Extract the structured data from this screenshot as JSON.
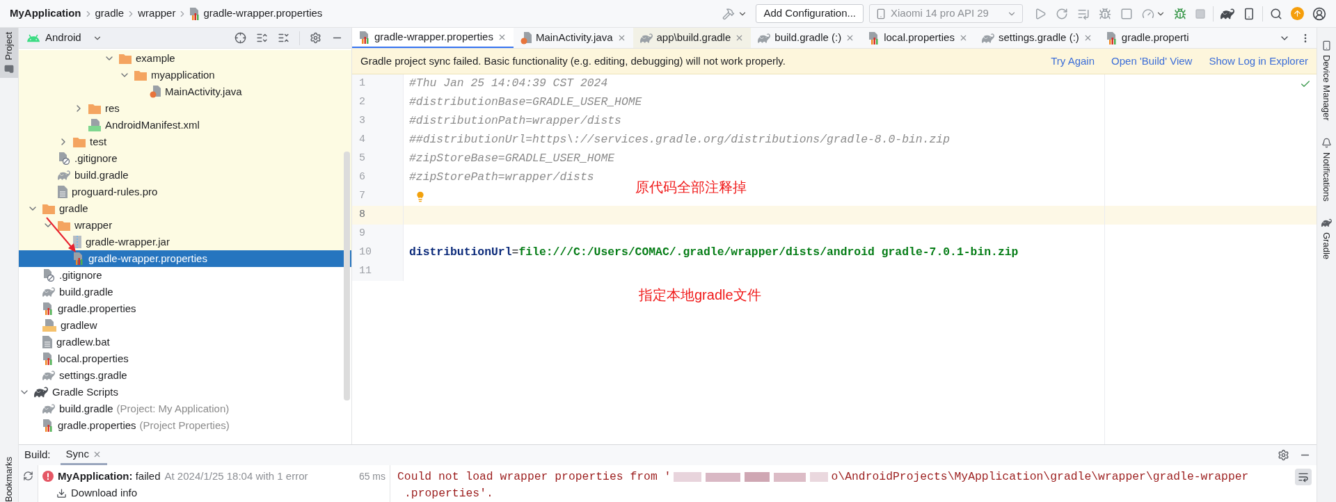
{
  "breadcrumbs": [
    {
      "label": "MyApplication",
      "kind": "project"
    },
    {
      "label": "gradle",
      "kind": "folder"
    },
    {
      "label": "wrapper",
      "kind": "folder"
    },
    {
      "label": "gradle-wrapper.properties",
      "kind": "properties"
    }
  ],
  "toolbar": {
    "run_config": "Add Configuration...",
    "device": {
      "label": "Xiaomi 14 pro API 29",
      "disabled": true
    }
  },
  "left_tool_windows": [
    {
      "label": "Project",
      "selected": true
    }
  ],
  "bookmarks": {
    "label": "Bookmarks"
  },
  "right_tool_windows": [
    {
      "label": "Device Manager",
      "kind": "device"
    },
    {
      "label": "Notifications",
      "kind": "bell"
    },
    {
      "label": "Gradle",
      "kind": "gradle"
    }
  ],
  "project_panel": {
    "view": "Android",
    "tree": [
      {
        "children": [
          {
            "children": [
              {
                "children": [
                  {
                    "children": [
                      {
                        "children": [
                          {
                            "children": [
                              {
                                "label": "example",
                                "kind": "folder",
                                "expanded": true,
                                "selected": false,
                                "highlighted": true,
                                "children": [
                                  {
                                    "label": "myapplication",
                                    "kind": "folder",
                                    "expanded": true,
                                    "selected": false,
                                    "highlighted": true,
                                    "children": [
                                      {
                                        "label": "MainActivity.java",
                                        "kind": "java",
                                        "selected": false,
                                        "highlighted": true
                                      }
                                    ]
                                  }
                                ]
                              }
                            ]
                          }
                        ]
                      },
                      {
                        "label": "res",
                        "kind": "folder",
                        "expanded": false,
                        "selected": false,
                        "highlighted": true
                      },
                      {
                        "label": "AndroidManifest.xml",
                        "kind": "manifest",
                        "selected": false,
                        "highlighted": true
                      }
                    ]
                  },
                  {
                    "label": "test",
                    "kind": "folder",
                    "expanded": false,
                    "selected": false,
                    "highlighted": true
                  }
                ]
              },
              {
                "label": ".gitignore",
                "kind": "ignore",
                "selected": false,
                "highlighted": true
              },
              {
                "label": "build.gradle",
                "kind": "gradle",
                "selected": false,
                "highlighted": true
              },
              {
                "label": "proguard-rules.pro",
                "kind": "text",
                "selected": false,
                "highlighted": true
              }
            ]
          },
          {
            "label": "gradle",
            "kind": "folder",
            "expanded": true,
            "selected": false,
            "highlighted": true,
            "children": [
              {
                "label": "wrapper",
                "kind": "folder",
                "expanded": true,
                "selected": false,
                "highlighted": true,
                "children": [
                  {
                    "label": "gradle-wrapper.jar",
                    "kind": "jar",
                    "selected": false,
                    "highlighted": true
                  },
                  {
                    "label": "gradle-wrapper.properties",
                    "kind": "properties",
                    "selected": true
                  }
                ]
              }
            ]
          },
          {
            "label": ".gitignore",
            "kind": "ignore",
            "selected": false,
            "highlighted": false
          },
          {
            "label": "build.gradle",
            "kind": "gradle",
            "selected": false,
            "highlighted": false
          },
          {
            "label": "gradle.properties",
            "kind": "properties",
            "selected": false,
            "highlighted": false
          },
          {
            "label": "gradlew",
            "kind": "shell",
            "selected": false,
            "highlighted": false
          },
          {
            "label": "gradlew.bat",
            "kind": "text",
            "selected": false,
            "highlighted": false
          },
          {
            "label": "local.properties",
            "kind": "properties",
            "selected": false,
            "highlighted": false
          },
          {
            "label": "settings.gradle",
            "kind": "gradle",
            "selected": false,
            "highlighted": false
          }
        ]
      },
      {
        "label": "Gradle Scripts",
        "kind": "scripts",
        "expanded": true,
        "selected": false,
        "highlighted": false,
        "children": [
          {
            "label": "build.gradle",
            "note": "(Project: My Application)",
            "kind": "gradle",
            "selected": false,
            "highlighted": false
          },
          {
            "label": "gradle.properties",
            "note": "(Project Properties)",
            "kind": "properties",
            "selected": false,
            "highlighted": false
          }
        ]
      }
    ]
  },
  "editor_tabs": [
    {
      "label": "gradle-wrapper.properties",
      "kind": "properties",
      "selected": true,
      "closable": true
    },
    {
      "label": "MainActivity.java",
      "kind": "java",
      "selected": false,
      "highlighted": false,
      "closable": true
    },
    {
      "label": "app\\build.gradle",
      "kind": "gradle",
      "selected": false,
      "highlighted": true,
      "closable": true
    },
    {
      "label": "build.gradle (:)",
      "kind": "gradle",
      "selected": false,
      "highlighted": false,
      "closable": true
    },
    {
      "label": "local.properties",
      "kind": "properties",
      "selected": false,
      "highlighted": false,
      "closable": true
    },
    {
      "label": "settings.gradle (:)",
      "kind": "gradle",
      "selected": false,
      "highlighted": false,
      "closable": true
    },
    {
      "label": "gradle.properti",
      "kind": "properties",
      "selected": false,
      "highlighted": false,
      "closable": false
    }
  ],
  "banner": {
    "message": "Gradle project sync failed. Basic functionality (e.g. editing, debugging) will not work properly.",
    "actions": [
      "Try Again",
      "Open 'Build' View",
      "Show Log in Explorer"
    ]
  },
  "editor": {
    "lines": [
      {
        "number": "1",
        "kind": "comment",
        "text": "#Thu Jan 25 14:04:39 CST 2024",
        "current": false,
        "bulb": false
      },
      {
        "number": "2",
        "kind": "comment",
        "text": "#distributionBase=GRADLE_USER_HOME",
        "current": false,
        "bulb": false
      },
      {
        "number": "3",
        "kind": "comment",
        "text": "#distributionPath=wrapper/dists",
        "current": false,
        "bulb": false
      },
      {
        "number": "4",
        "kind": "comment",
        "text": "##distributionUrl=https\\://services.gradle.org/distributions/gradle-8.0-bin.zip",
        "current": false,
        "bulb": false
      },
      {
        "number": "5",
        "kind": "comment",
        "text": "#zipStoreBase=GRADLE_USER_HOME",
        "current": false,
        "bulb": false
      },
      {
        "number": "6",
        "kind": "comment",
        "text": "#zipStorePath=wrapper/dists",
        "current": false,
        "bulb": false
      },
      {
        "number": "7",
        "kind": "blank",
        "current": false,
        "bulb": true
      },
      {
        "number": "8",
        "kind": "blank",
        "current": true,
        "bulb": false
      },
      {
        "number": "9",
        "kind": "blank",
        "current": false,
        "bulb": false
      },
      {
        "number": "10",
        "kind": "property",
        "key": "distributionUrl",
        "separator": "=",
        "value": "file:///C:/Users/COMAC/.gradle/wrapper/dists/android gradle-7.0.1-bin.zip",
        "current": false,
        "bulb": false
      },
      {
        "number": "11",
        "kind": "blank",
        "current": false,
        "bulb": false
      }
    ],
    "annotations": [
      "原代码全部注释掉",
      "指定本地gradle文件"
    ]
  },
  "build_panel": {
    "title": "Build:",
    "tabs": [
      {
        "label": "Sync",
        "selected": true
      }
    ],
    "tree": [
      {
        "kind": "error",
        "text": "**MyApplication:** failed",
        "detail": "At 2024/1/25 18:04 with 1 error",
        "time": "65 ms"
      },
      {
        "kind": "download",
        "text": "Download info"
      }
    ],
    "console": {
      "line1_start": "Could not load wrapper properties from '",
      "line1_end": "o\\AndroidProjects\\MyApplication\\gradle\\wrapper\\gradle-wrapper",
      "line2": ".properties'."
    }
  }
}
